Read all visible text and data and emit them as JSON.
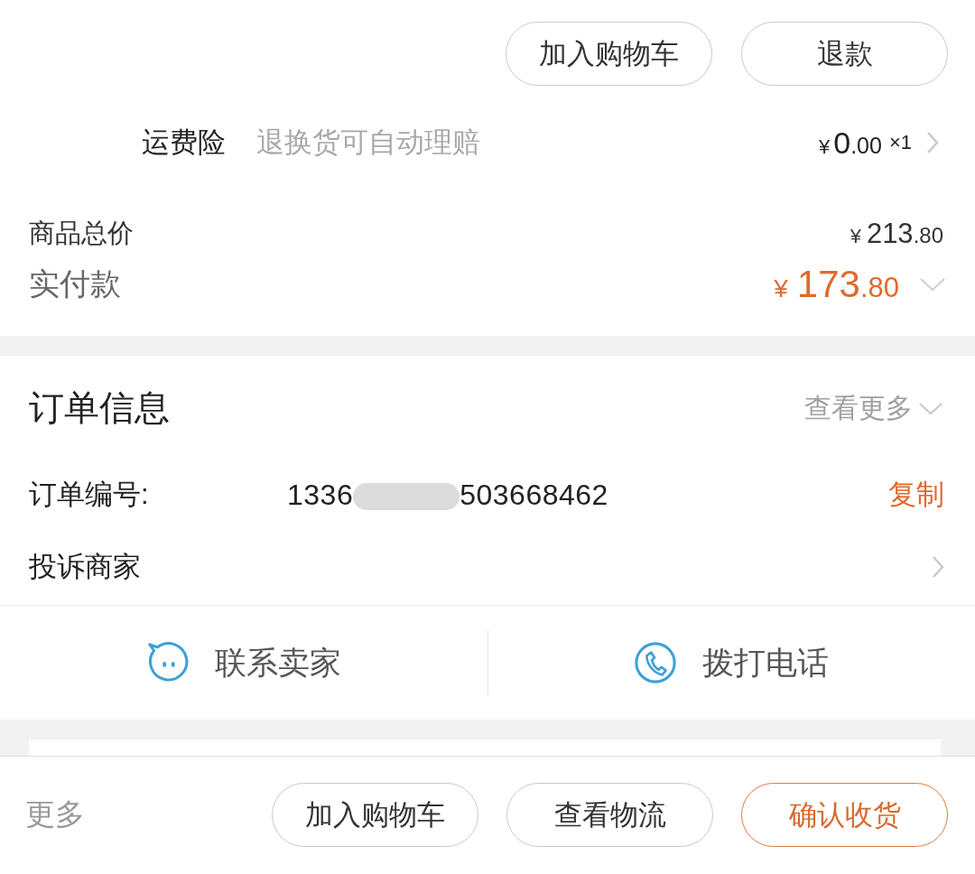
{
  "top_actions": {
    "buttons": [
      {
        "label": "加入购物车"
      },
      {
        "label": "退款"
      }
    ]
  },
  "shipping_insurance": {
    "label": "运费险",
    "description": "退换货可自动理赔",
    "price": {
      "currency": "¥",
      "integer": "0",
      "decimal": ".00"
    },
    "quantity": "×1"
  },
  "totals": [
    {
      "kind": "subtotal",
      "label": "商品总价",
      "price": {
        "currency": "¥",
        "integer": "213",
        "decimal": ".80"
      }
    },
    {
      "kind": "paid",
      "label": "实付款",
      "price": {
        "currency": "¥",
        "integer": "173",
        "decimal": ".80"
      }
    }
  ],
  "order_info": {
    "title": "订单信息",
    "more_link": "查看更多",
    "rows": [
      {
        "kind": "order_number",
        "label": "订单编号:",
        "value_parts": [
          "1336",
          "503668462"
        ],
        "redacted": true,
        "action": "复制"
      },
      {
        "kind": "link",
        "label": "投诉商家"
      }
    ]
  },
  "contact": [
    {
      "kind": "chat",
      "label": "联系卖家"
    },
    {
      "kind": "phone",
      "label": "拨打电话"
    }
  ],
  "bottom_bar": {
    "more": "更多",
    "buttons": [
      {
        "kind": "plain",
        "label": "加入购物车"
      },
      {
        "kind": "plain",
        "label": "查看物流"
      },
      {
        "kind": "primary",
        "label": "确认收货"
      }
    ]
  }
}
